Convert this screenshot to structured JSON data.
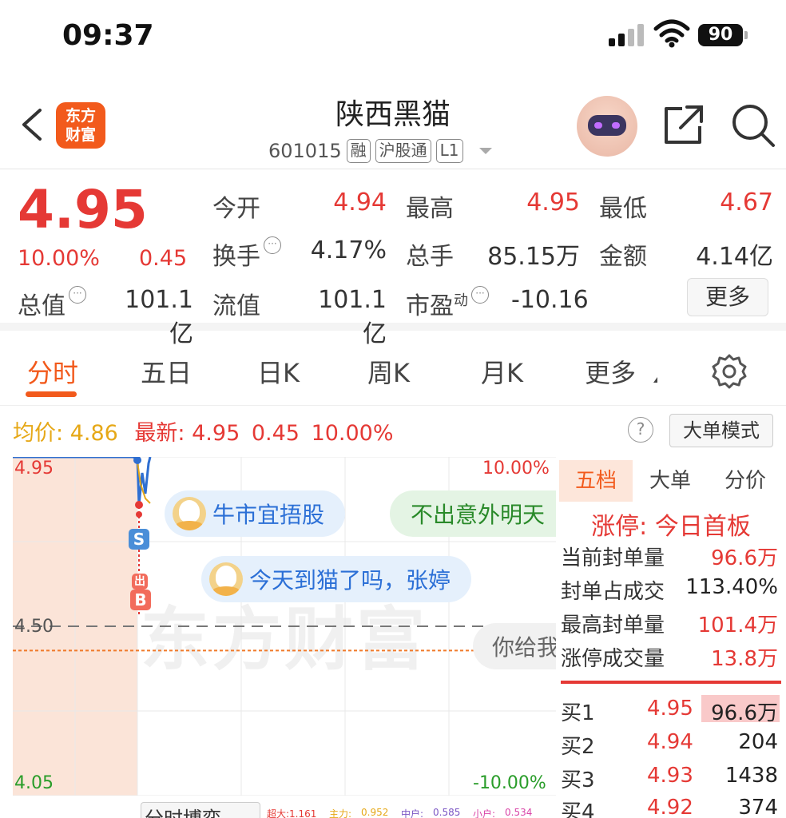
{
  "status": {
    "time": "09:37",
    "battery": "90"
  },
  "header": {
    "logo_line1": "东方",
    "logo_line2": "财富",
    "stock_name": "陕西黑猫",
    "stock_code": "601015",
    "tags": [
      "融",
      "沪股通",
      "L1"
    ]
  },
  "quote": {
    "price": "4.95",
    "change_pct": "10.00%",
    "change_amt": "0.45",
    "items": {
      "open": {
        "label": "今开",
        "value": "4.94"
      },
      "high": {
        "label": "最高",
        "value": "4.95"
      },
      "low": {
        "label": "最低",
        "value": "4.67"
      },
      "turnover": {
        "label": "换手",
        "value": "4.17%"
      },
      "volume": {
        "label": "总手",
        "value": "85.15万"
      },
      "amount": {
        "label": "金额",
        "value": "4.14亿"
      },
      "total_cap": {
        "label": "总值",
        "value": "101.1亿"
      },
      "float_cap": {
        "label": "流值",
        "value": "101.1亿"
      },
      "pe": {
        "label": "市盈",
        "sup": "动",
        "value": "-10.16"
      }
    },
    "more_label": "更多"
  },
  "tabs": [
    "分时",
    "五日",
    "日K",
    "周K",
    "月K",
    "更多"
  ],
  "avg_bar": {
    "avg_label": "均价:",
    "avg_value": "4.86",
    "latest_label": "最新:",
    "latest_price": "4.95",
    "latest_chg": "0.45",
    "latest_pct": "10.00%",
    "help_icon": "?",
    "mode_button": "大单模式"
  },
  "chart": {
    "watermark": "东方财富",
    "y_top": "4.95",
    "y_mid": "4.50",
    "y_bottom": "4.05",
    "pct_top": "10.00%",
    "pct_bottom": "-10.00%",
    "bubbles": [
      "牛市宜捂股",
      "不出意外明天",
      "今天到猫了吗，张婷",
      "你给我"
    ],
    "markers": [
      "S",
      "B"
    ],
    "marker_lower_text": "出"
  },
  "chart_data": {
    "type": "line",
    "ylim": [
      4.05,
      4.95
    ],
    "y_ticks": [
      "4.95",
      "4.50",
      "4.05"
    ],
    "right_ticks": [
      "10.00%",
      "-10.00%"
    ],
    "reference_price": 4.5,
    "average_price": 4.86,
    "last_price": 4.95
  },
  "panel": {
    "tabs": [
      "五档",
      "大单",
      "分价"
    ],
    "limit_title": "涨停: 今日首板",
    "rows": [
      {
        "label": "当前封单量",
        "value": "96.6万"
      },
      {
        "label": "封单占成交",
        "value": "113.40%"
      },
      {
        "label": "最高封单量",
        "value": "101.4万"
      },
      {
        "label": "涨停成交量",
        "value": "13.8万"
      }
    ],
    "orderbook": [
      {
        "label": "买1",
        "price": "4.95",
        "vol": "96.6万"
      },
      {
        "label": "买2",
        "price": "4.94",
        "vol": "204"
      },
      {
        "label": "买3",
        "price": "4.93",
        "vol": "1438"
      },
      {
        "label": "买4",
        "price": "4.92",
        "vol": "374"
      }
    ]
  },
  "bottom": {
    "button": "分时博弈",
    "items": [
      "超大:1.161",
      "主力:",
      "0.952",
      "中户:",
      "0.585",
      "小户:",
      "0.534"
    ]
  },
  "colors": {
    "up": "#e53935",
    "brand": "#f25a1c",
    "down": "#2a9d2a",
    "avg": "#e6a817"
  }
}
